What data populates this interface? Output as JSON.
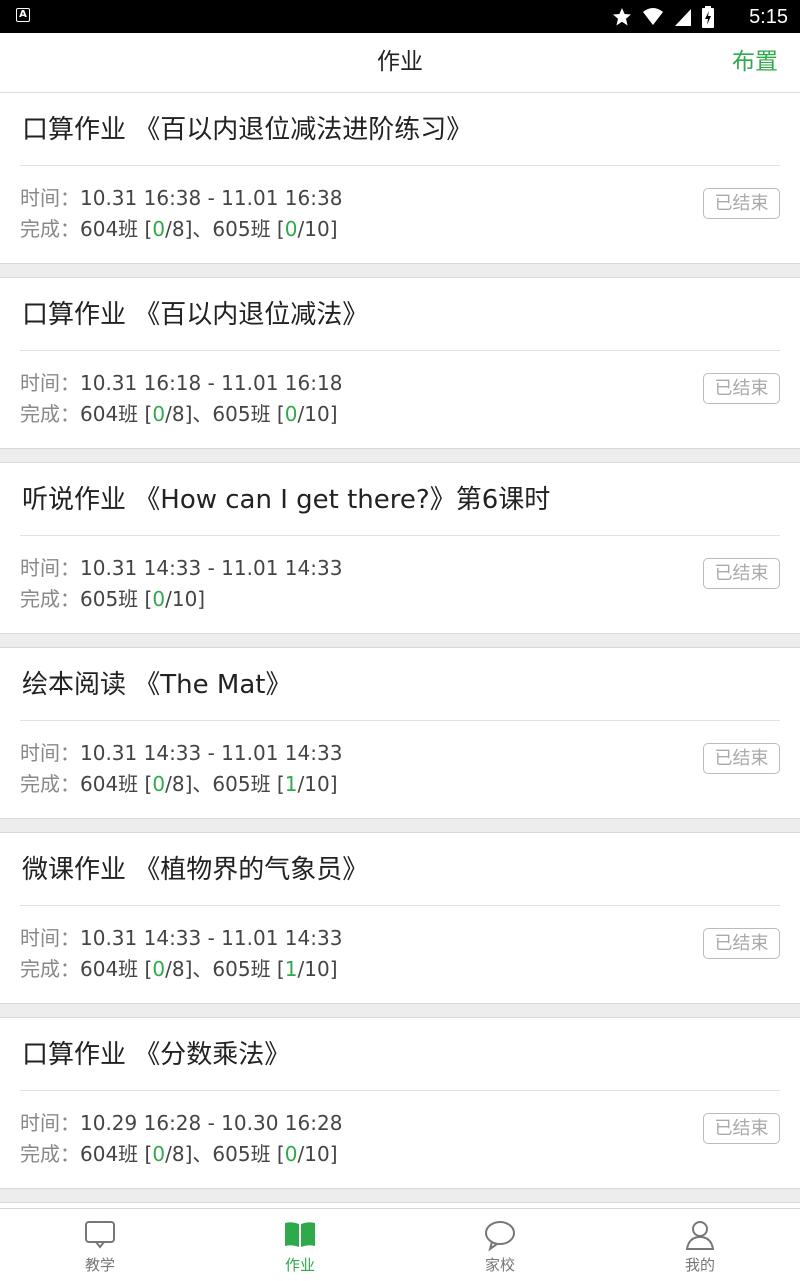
{
  "status_bar": {
    "time": "5:15",
    "notification_icon": "A"
  },
  "header": {
    "title": "作业",
    "action": "布置"
  },
  "labels": {
    "time_prefix": "时间：",
    "done_prefix": "完成：",
    "badge": "已结束"
  },
  "colors": {
    "accent": "#2faa4a"
  },
  "homework": [
    {
      "title": "口算作业 《百以内退位减法进阶练习》",
      "time": "10.31 16:38 - 11.01 16:38",
      "classes": [
        {
          "name": "604班",
          "done": "0",
          "total": "8"
        },
        {
          "name": "605班",
          "done": "0",
          "total": "10"
        }
      ],
      "status": "已结束"
    },
    {
      "title": "口算作业 《百以内退位减法》",
      "time": "10.31 16:18 - 11.01 16:18",
      "classes": [
        {
          "name": "604班",
          "done": "0",
          "total": "8"
        },
        {
          "name": "605班",
          "done": "0",
          "total": "10"
        }
      ],
      "status": "已结束"
    },
    {
      "title": "听说作业 《How can I get there?》第6课时",
      "time": "10.31 14:33 - 11.01 14:33",
      "classes": [
        {
          "name": "605班",
          "done": "0",
          "total": "10"
        }
      ],
      "status": "已结束"
    },
    {
      "title": "绘本阅读 《The Mat》",
      "time": "10.31 14:33 - 11.01 14:33",
      "classes": [
        {
          "name": "604班",
          "done": "0",
          "total": "8"
        },
        {
          "name": "605班",
          "done": "1",
          "total": "10"
        }
      ],
      "status": "已结束"
    },
    {
      "title": "微课作业 《植物界的气象员》",
      "time": "10.31 14:33 - 11.01 14:33",
      "classes": [
        {
          "name": "604班",
          "done": "0",
          "total": "8"
        },
        {
          "name": "605班",
          "done": "1",
          "total": "10"
        }
      ],
      "status": "已结束"
    },
    {
      "title": "口算作业 《分数乘法》",
      "time": "10.29 16:28 - 10.30 16:28",
      "classes": [
        {
          "name": "604班",
          "done": "0",
          "total": "8"
        },
        {
          "name": "605班",
          "done": "0",
          "total": "10"
        }
      ],
      "status": "已结束"
    }
  ],
  "tabs": [
    {
      "label": "教学",
      "icon": "chat-board-icon",
      "active": false
    },
    {
      "label": "作业",
      "icon": "book-icon",
      "active": true
    },
    {
      "label": "家校",
      "icon": "speech-bubble-icon",
      "active": false
    },
    {
      "label": "我的",
      "icon": "person-icon",
      "active": false
    }
  ]
}
